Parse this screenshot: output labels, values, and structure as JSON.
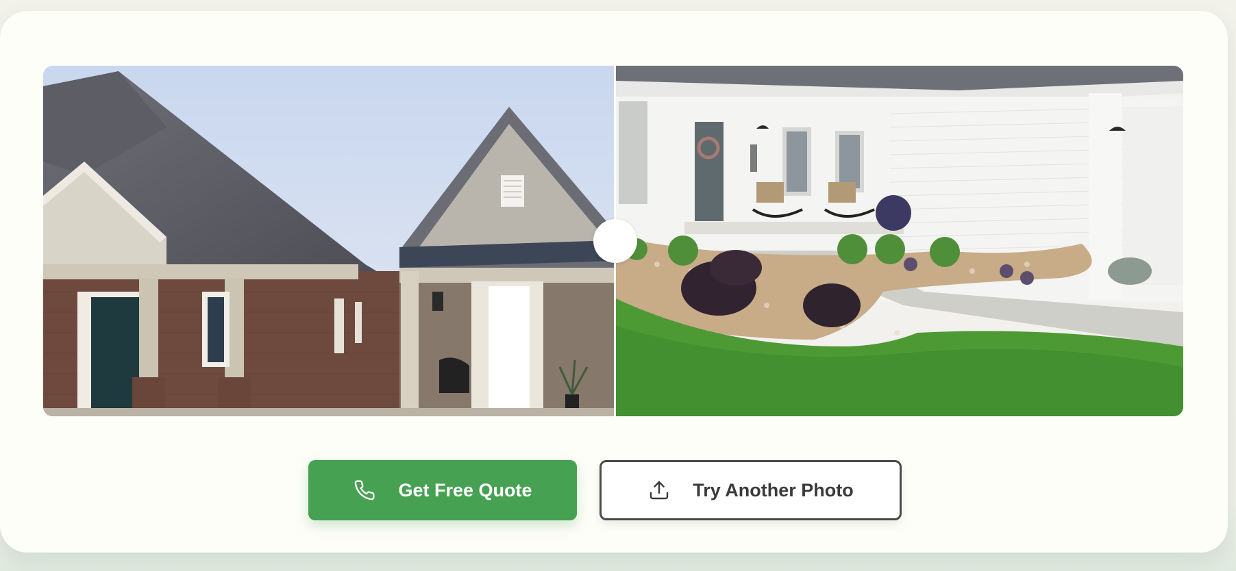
{
  "comparison": {
    "before_image": "house-before-landscaping",
    "after_image": "house-after-landscaping",
    "split_position": 0.5
  },
  "actions": {
    "primary": {
      "label": "Get Free Quote",
      "icon": "phone-icon",
      "color": "#46a152"
    },
    "secondary": {
      "label": "Try Another Photo",
      "icon": "upload-icon",
      "color": "#4a4a4a"
    }
  }
}
